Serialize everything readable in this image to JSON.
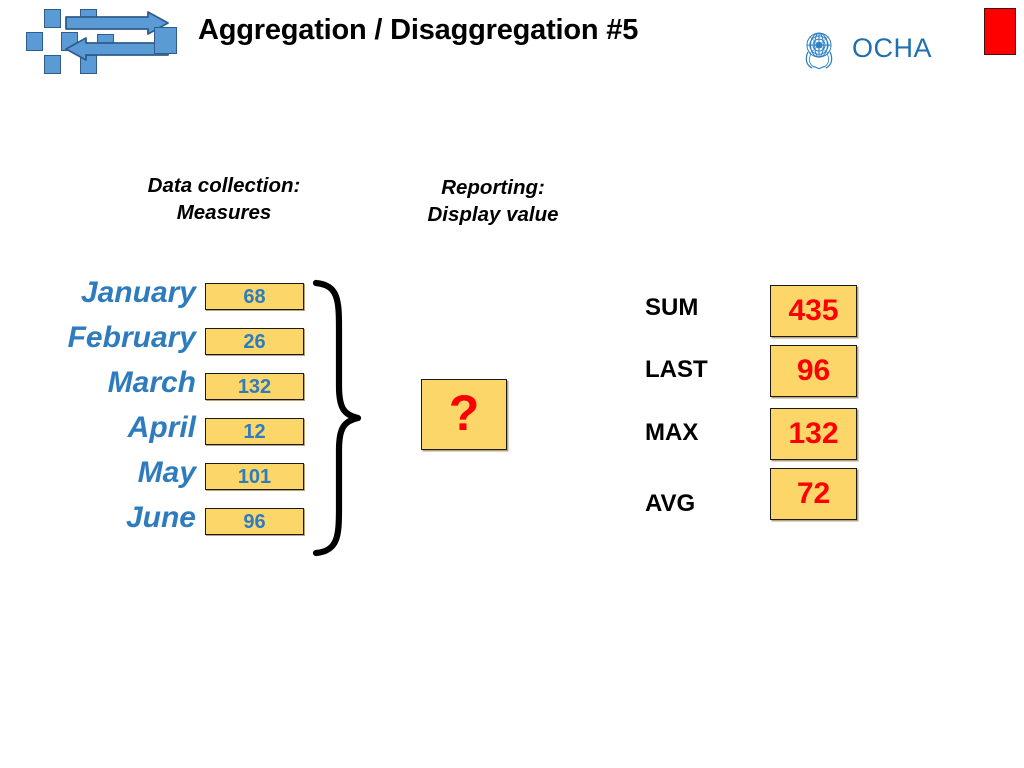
{
  "header": {
    "title": "Aggregation / Disaggregation #5",
    "logo_icon": "aggregation-disaggregation-icon",
    "arrow_right_icon": "arrow-right-icon",
    "arrow_left_icon": "arrow-left-icon",
    "un_emblem_icon": "un-emblem-icon",
    "ocha_label": "OCHA",
    "flag_marker_icon": "red-flag-marker",
    "colors": {
      "icon_blue": "#5B9BD5",
      "icon_blue_border": "#2F5C8A",
      "ocha_blue": "#1F6FB2",
      "flag_red": "#FF0000"
    }
  },
  "columns": {
    "data_collection": "Data collection:\nMeasures",
    "reporting": "Reporting:\nDisplay value"
  },
  "measures": {
    "rows": [
      {
        "month": "January",
        "value": "68"
      },
      {
        "month": "February",
        "value": "26"
      },
      {
        "month": "March",
        "value": "132"
      },
      {
        "month": "April",
        "value": "12"
      },
      {
        "month": "May",
        "value": "101"
      },
      {
        "month": "June",
        "value": "96"
      }
    ],
    "brace_icon": "curly-brace-right",
    "colors": {
      "month_blue": "#2E7CBE",
      "box_fill": "#FCD669",
      "box_border": "#1A1A1A"
    }
  },
  "display_value": {
    "symbol": "?",
    "icon": "question-mark-icon",
    "color": "#FF0000"
  },
  "aggregations": {
    "rows": [
      {
        "label": "SUM",
        "value": "435"
      },
      {
        "label": "LAST",
        "value": "96"
      },
      {
        "label": "MAX",
        "value": "132"
      },
      {
        "label": "AVG",
        "value": "72"
      }
    ],
    "colors": {
      "value_red": "#FF0000",
      "box_fill": "#FCD669",
      "label_black": "#000000"
    }
  },
  "chart_data": {
    "type": "table",
    "title": "Aggregation / Disaggregation #5",
    "categories": [
      "January",
      "February",
      "March",
      "April",
      "May",
      "June"
    ],
    "values": [
      68,
      26,
      132,
      12,
      101,
      96
    ],
    "ylabel": "Measures",
    "aggregations": {
      "SUM": 435,
      "LAST": 96,
      "MAX": 132,
      "AVG": 72
    }
  }
}
